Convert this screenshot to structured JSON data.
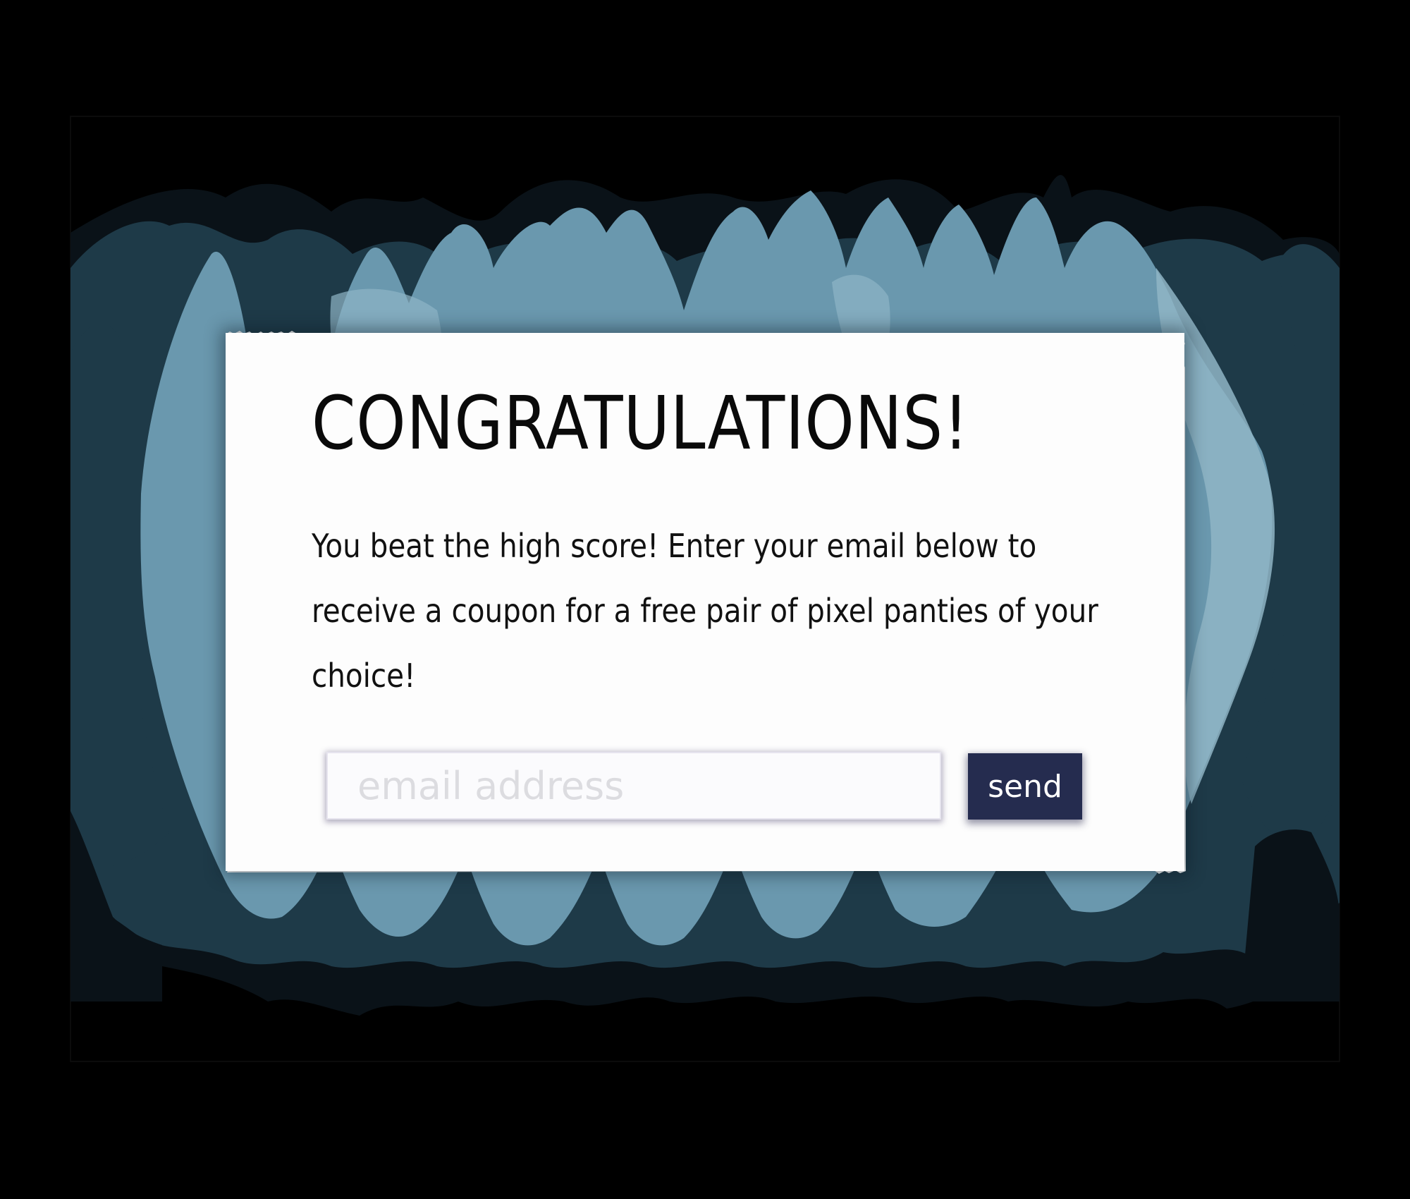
{
  "popup": {
    "title": "CONGRATULATIONS!",
    "message": "You beat the high score! Enter your email below to receive a coupon for a free pair of pixel panties of your choice!",
    "email_placeholder": "email address",
    "send_label": "send"
  },
  "colors": {
    "background": "#000000",
    "cave_dark": "#0a1218",
    "cave_mid": "#1e3a48",
    "cave_blue": "#6a98ae",
    "cave_light": "#8fb5c6",
    "cave_glow": "#bdebef",
    "card": "#fdfdfd",
    "button": "#252c4f"
  }
}
